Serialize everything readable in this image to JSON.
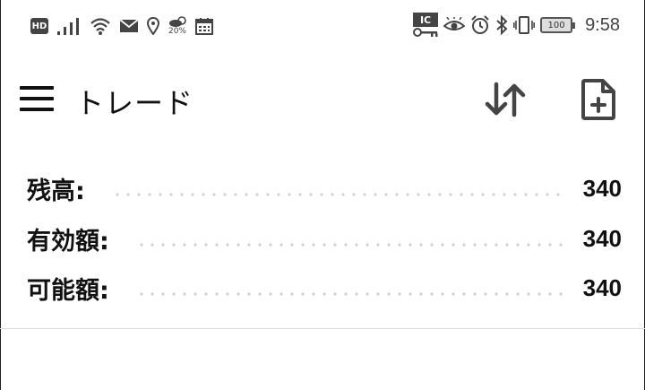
{
  "status_bar": {
    "left_icons": [
      "hd-icon",
      "signal-icon",
      "wifi-icon",
      "mail-icon",
      "location-icon",
      "weather-icon",
      "calendar-icon"
    ],
    "hd_label": "HD",
    "weather_percent": "20%",
    "right_icons": [
      "ic-key-icon",
      "eye-icon",
      "alarm-icon",
      "bluetooth-icon",
      "vibrate-icon",
      "battery-icon"
    ],
    "ic_label": "IC",
    "battery_level": "100",
    "time": "9:58"
  },
  "app_bar": {
    "title": "トレード",
    "icons": [
      "menu-icon",
      "sort-icon",
      "new-document-icon"
    ]
  },
  "balances": {
    "rows": [
      {
        "label": "残高:",
        "value": "340"
      },
      {
        "label": "有効額:",
        "value": "340"
      },
      {
        "label": "可能額:",
        "value": "340"
      }
    ]
  },
  "colors": {
    "text": "#111111",
    "icon": "#444444",
    "dots": "#cfcfcf",
    "divider": "#dddddd"
  }
}
